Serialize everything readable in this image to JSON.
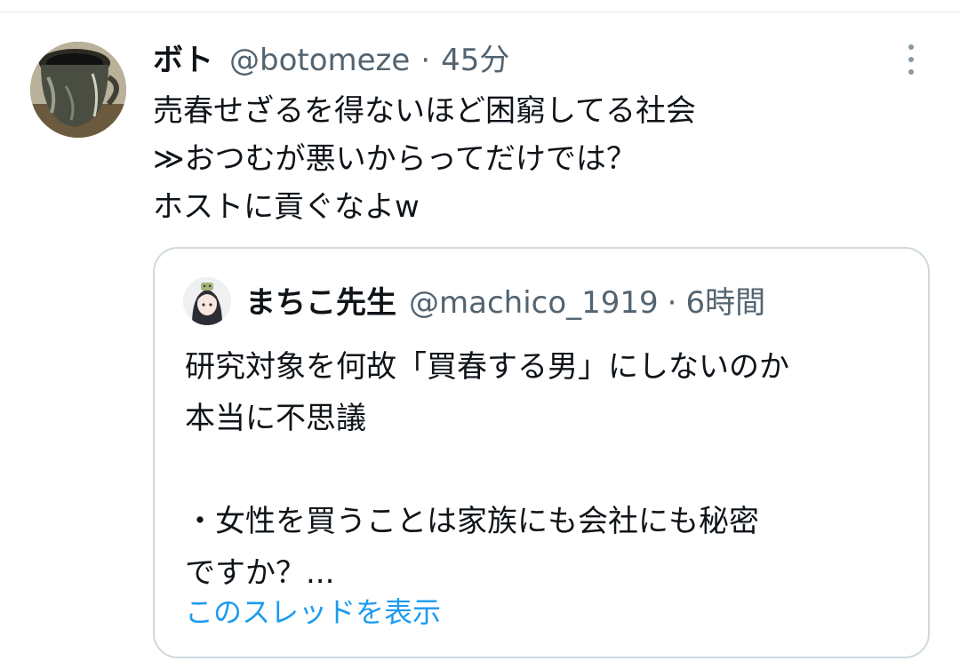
{
  "tweet": {
    "display_name": "ボト",
    "handle": "@botomeze",
    "separator": "·",
    "time": "45分",
    "text": "売春せざるを得ないほど困窮してる社会\n≫おつむが悪いからってだけでは？\nホストに貢ぐなよw",
    "avatar_icon": "user-avatar-coffee-cup",
    "more_icon": "more-vertical-icon"
  },
  "quote": {
    "display_name": "まちこ先生",
    "handle": "@machico_1919",
    "separator": "·",
    "time": "6時間",
    "text": "研究対象を何故「買春する男」にしないのか\n本当に不思議\n\n・女性を買うことは家族にも会社にも秘密\nですか？...",
    "show_thread_label": "このスレッドを表示",
    "link_color": "#1d9bf0"
  }
}
